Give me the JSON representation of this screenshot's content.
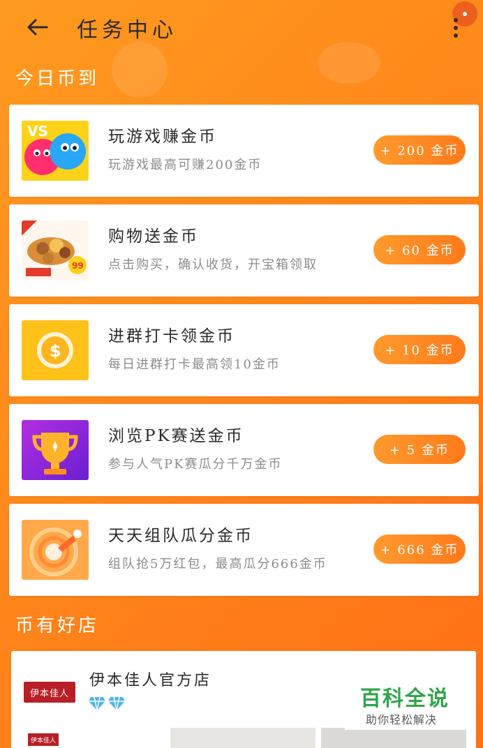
{
  "header": {
    "title": "任务中心"
  },
  "sections": {
    "checkin_title": "今日币到",
    "shop_title": "币有好店"
  },
  "tasks": [
    {
      "title": "玩游戏赚金币",
      "desc": "玩游戏最高可赚200金币",
      "reward": "+ 200 金币",
      "icon": "vs-game-icon",
      "thumb_label": "VS"
    },
    {
      "title": "购物送金币",
      "desc": "点击购买，确认收货，开宝箱领取",
      "reward": "+ 60 金币",
      "icon": "shopping-basket-icon",
      "thumb_label": "99"
    },
    {
      "title": "进群打卡领金币",
      "desc": "每日进群打卡最高领10金币",
      "reward": "+ 10 金币",
      "icon": "dollar-coin-icon",
      "thumb_label": "$"
    },
    {
      "title": "浏览PK赛送金币",
      "desc": "参与人气PK赛瓜分千万金币",
      "reward": "+ 5 金币",
      "icon": "trophy-icon",
      "thumb_label": ""
    },
    {
      "title": "天天组队瓜分金币",
      "desc": "组队抢5万红包，最高瓜分666金币",
      "reward": "+ 666 金币",
      "icon": "team-red-packet-icon",
      "thumb_label": ""
    }
  ],
  "shop": {
    "name": "伊本佳人官方店",
    "logo_text": "伊本佳人",
    "logo_small_text": "伊本佳人",
    "badge_count": 2
  },
  "watermark": {
    "title": "百科全说",
    "subtitle": "助你轻松解决"
  },
  "colors": {
    "background_start": "#ff9a1f",
    "background_end": "#ff6f16",
    "reward_button": "#ff8a22",
    "watermark_green": "#27a243",
    "shop_logo_red": "#b81f26"
  }
}
